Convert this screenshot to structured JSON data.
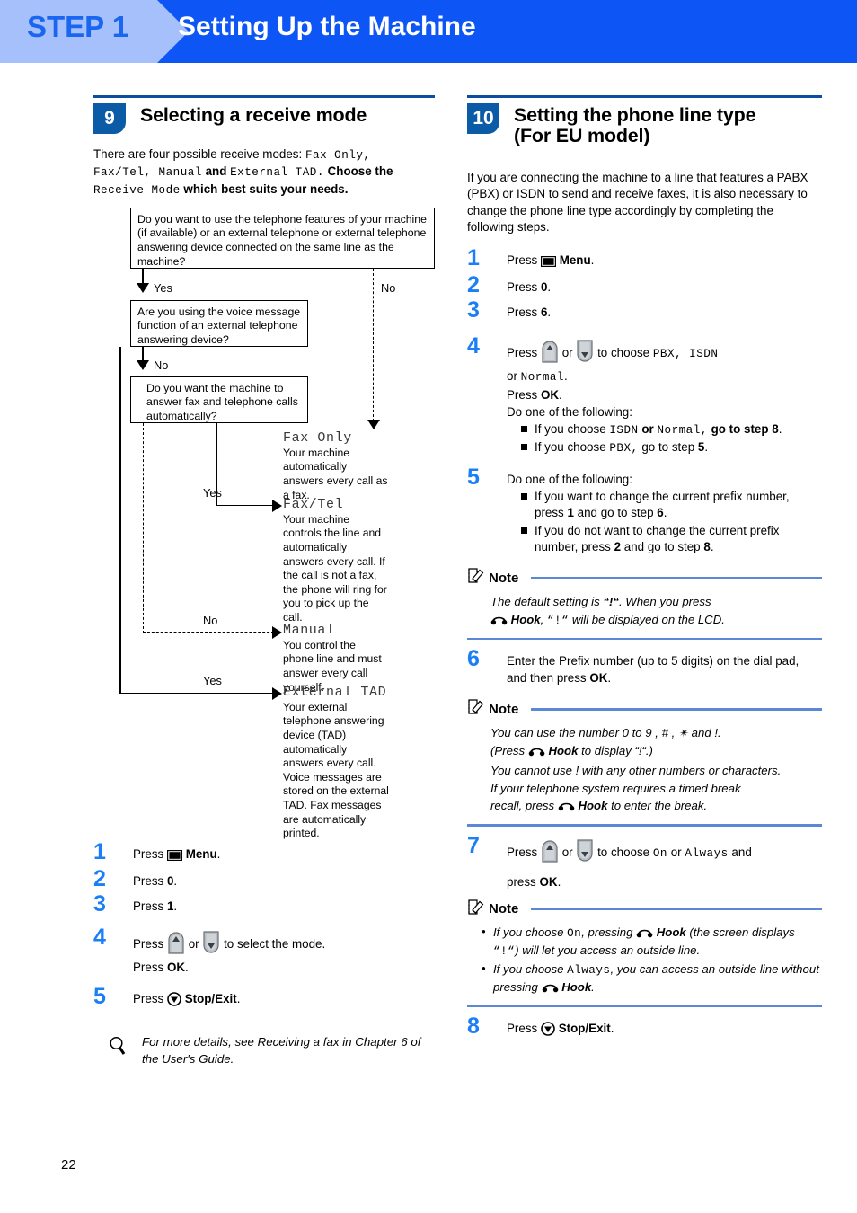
{
  "header": {
    "step_label": "STEP 1",
    "title": "Setting Up the Machine",
    "bar_color": "#0d55f5",
    "step_color": "#a6c0fb"
  },
  "page_number": "22",
  "left_column": {
    "section": {
      "number": "9",
      "title": "Selecting a receive mode",
      "intro_1": "There are four possible receive modes: ",
      "intro_lcd_1": "Fax Only,",
      "intro_lcd_2": "Fax/Tel, Manual",
      "intro_2": " and ",
      "intro_lcd_3": "External TAD.",
      "intro_3": " Choose the ",
      "intro_lcd_4": "Receive Mode",
      "intro_4": " which best suits your needs."
    },
    "flowchart": {
      "box1": "Do you want to use the telephone features of your machine (if available) or an external telephone or external telephone answering device connected on the same line as the machine?",
      "box1_yes": "Yes",
      "box1_no": "No",
      "box2": "Are you using the voice message function of an external telephone answering device?",
      "box2_no": "No",
      "box2_yes": "Yes",
      "box3": "Do you want the machine to answer fax and telephone calls automatically?",
      "box3_yes": "Yes",
      "box3_no": "No",
      "modes": [
        {
          "name": "Fax Only",
          "desc": "Your machine automatically answers every call as a fax."
        },
        {
          "name": "Fax/Tel",
          "desc": "Your machine controls the line and automatically answers every call. If the call is not a fax, the phone will ring for you to pick up the call."
        },
        {
          "name": "Manual",
          "desc": "You control the phone line and must answer every call yourself."
        },
        {
          "name": "External TAD",
          "desc": "Your external telephone answering device (TAD) automatically answers every call. Voice messages are stored on the external TAD. Fax messages are automatically  printed."
        }
      ]
    },
    "steps": [
      {
        "num": "1",
        "press": "Press ",
        "icon": "menu-icon",
        "label": "Menu",
        "tail": "."
      },
      {
        "num": "2",
        "press": "Press ",
        "label": "0",
        "tail": "."
      },
      {
        "num": "3",
        "press": "Press ",
        "label": "1",
        "tail": "."
      },
      {
        "num": "4",
        "press": "Press ",
        "mid": " or ",
        "after": " to select the mode.",
        "line2_pre": "Press ",
        "line2_bold": "OK",
        "line2_tail": "."
      },
      {
        "num": "5",
        "press": "Press ",
        "icon": "stop-exit-icon",
        "label": "Stop/Exit",
        "tail": "."
      }
    ],
    "tip": {
      "icon": "magnifier-icon",
      "text": "For more details, see Receiving a fax in Chapter 6 of the User's Guide."
    }
  },
  "right_column": {
    "section": {
      "number": "10",
      "title_line1": "Setting the phone line type",
      "title_line2": "(For EU model)",
      "intro": "If you are connecting the machine to a line that features a PABX (PBX) or ISDN to send and receive faxes, it is also necessary to change the phone line type accordingly by completing the following steps."
    },
    "steps": {
      "s1": {
        "num": "1",
        "press": "Press ",
        "label": "Menu",
        "tail": "."
      },
      "s2": {
        "num": "2",
        "press": "Press ",
        "label": "0",
        "tail": "."
      },
      "s3": {
        "num": "3",
        "press": "Press ",
        "label": "6",
        "tail": "."
      },
      "s4": {
        "num": "4",
        "press": "Press ",
        "mid": " or ",
        "choose": " to choose ",
        "opt1": "PBX, ISDN",
        "line2_pre": "or ",
        "opt2": "Normal",
        "line2_tail": ".",
        "line3_pre": "Press ",
        "line3_bold": "OK",
        "line3_tail": ".",
        "do_one": "Do one of the following:",
        "b1_a": "If you choose ",
        "b1_lcd1": "ISDN",
        "b1_b": " or ",
        "b1_lcd2": "Normal,",
        "b1_c": " go to step ",
        "b1_num": "8",
        "b1_d": ".",
        "b2_a": "If you choose ",
        "b2_lcd": "PBX,",
        "b2_b": " go to step ",
        "b2_num": "5",
        "b2_c": "."
      },
      "s5": {
        "num": "5",
        "do_one": "Do one of the following:",
        "b1_a": "If you want to change the current prefix number, press ",
        "b1_num": "1",
        "b1_b": " and go to step ",
        "b1_num2": "6",
        "b1_c": ".",
        "b2_a": "If you do not want to change the current prefix number, press ",
        "b2_num": "2",
        "b2_b": " and go to step ",
        "b2_num2": "8",
        "b2_c": "."
      },
      "s6": {
        "num": "6",
        "text_a": "Enter the Prefix number (up to 5 digits) on the dial pad, and then press ",
        "text_bold": "OK",
        "text_b": "."
      },
      "s7": {
        "num": "7",
        "press": "Press ",
        "mid": " or ",
        "choose": " to choose ",
        "opt1": "On",
        "or": " or ",
        "opt2": "Always",
        "and": " and",
        "line2_pre": "press ",
        "line2_bold": "OK",
        "line2_tail": "."
      },
      "s8": {
        "num": "8",
        "press": "Press ",
        "label": "Stop/Exit",
        "tail": "."
      }
    },
    "notes": {
      "note_label": "Note",
      "note1": {
        "l1_a": "The default setting is ",
        "l1_b": "“!“",
        "l1_c": ". When you press",
        "l2_bold": "Hook",
        "l2_a": ", ",
        "l2_lcd": "“!“",
        "l2_b": " will be displayed on the LCD."
      },
      "note2": {
        "l1": "You can use the number 0 to 9 , # , ✴ and !.",
        "l2_a": "(Press ",
        "l2_bold": "Hook",
        "l2_b": " to display “!“.)",
        "l3": "You cannot use ! with any other numbers or characters.",
        "l4": "If your telephone system requires a timed break",
        "l5_a": "recall, press ",
        "l5_bold": "Hook",
        "l5_b": " to enter the break."
      },
      "note3": {
        "b1_a": "If you choose ",
        "b1_lcd": "On",
        "b1_b": ", pressing ",
        "b1_bold": "Hook",
        "b1_c": " (the screen displays ",
        "b1_lcd2": "“!“",
        "b1_d": ") will let you access an outside line.",
        "b2_a": "If you choose ",
        "b2_lcd": "Always",
        "b2_b": ", you can access an outside line without pressing ",
        "b2_bold": "Hook",
        "b2_c": "."
      }
    }
  },
  "icons": {
    "menu": "menu-icon",
    "up_key": "up-arrow-key-icon",
    "down_key": "down-arrow-key-icon",
    "stop_exit": "stop-exit-icon",
    "hook": "hook-icon",
    "note": "note-pencil-icon",
    "magnifier": "magnifier-icon"
  }
}
